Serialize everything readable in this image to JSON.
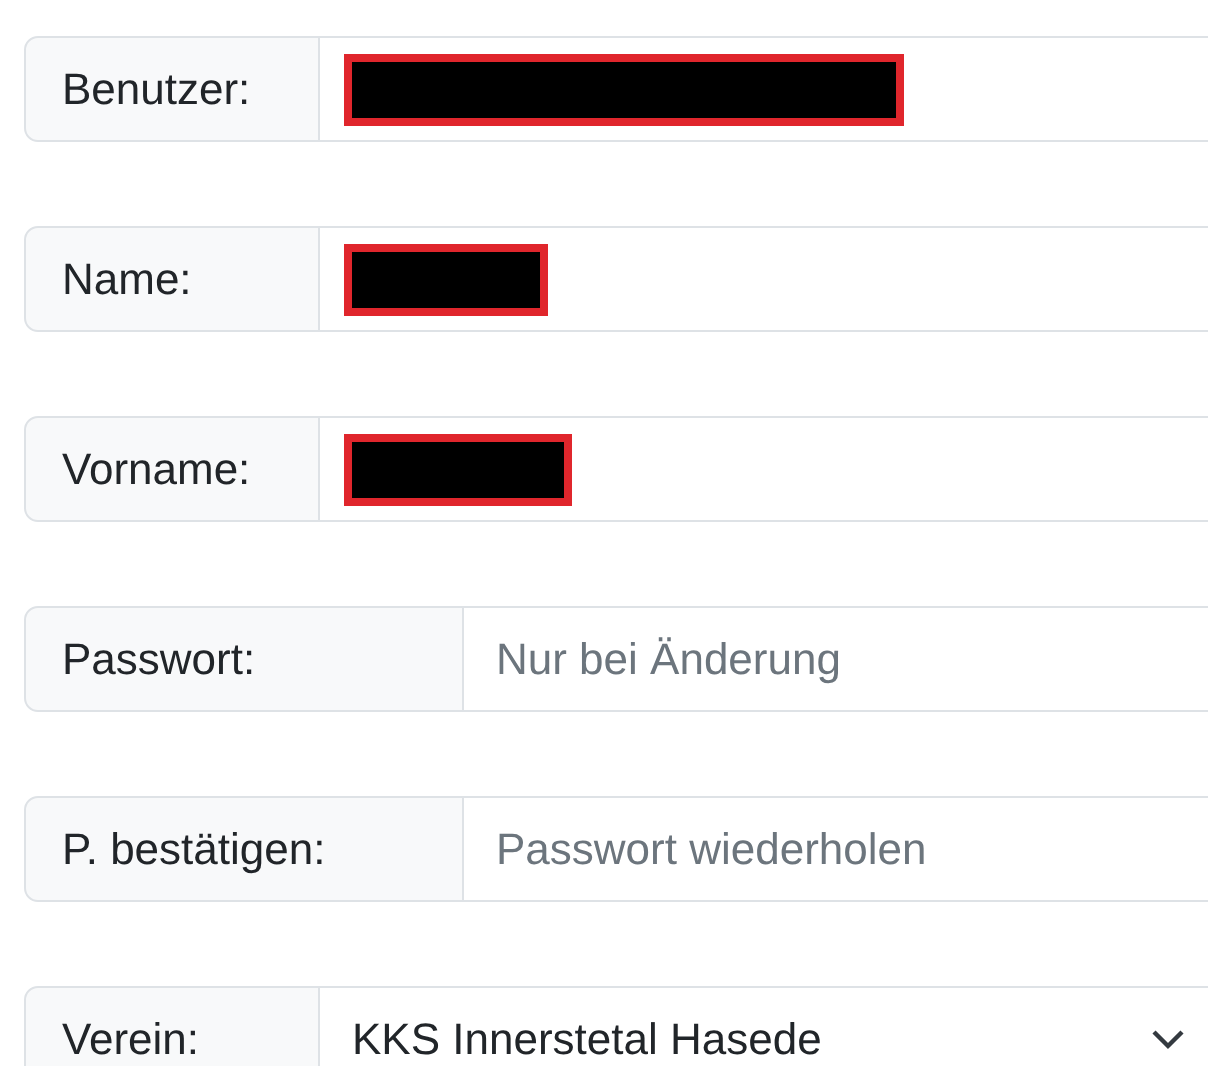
{
  "fields": [
    {
      "label": "Benutzer:",
      "kind": "redacted"
    },
    {
      "label": "Name:",
      "kind": "redacted"
    },
    {
      "label": "Vorname:",
      "kind": "redacted"
    },
    {
      "label": "Passwort:",
      "kind": "password",
      "placeholder": "Nur bei Änderung"
    },
    {
      "label": "P. bestätigen:",
      "kind": "password",
      "placeholder": "Passwort wiederholen"
    },
    {
      "label": "Verein:",
      "kind": "select",
      "value": "KKS Innerstetal Hasede"
    }
  ]
}
